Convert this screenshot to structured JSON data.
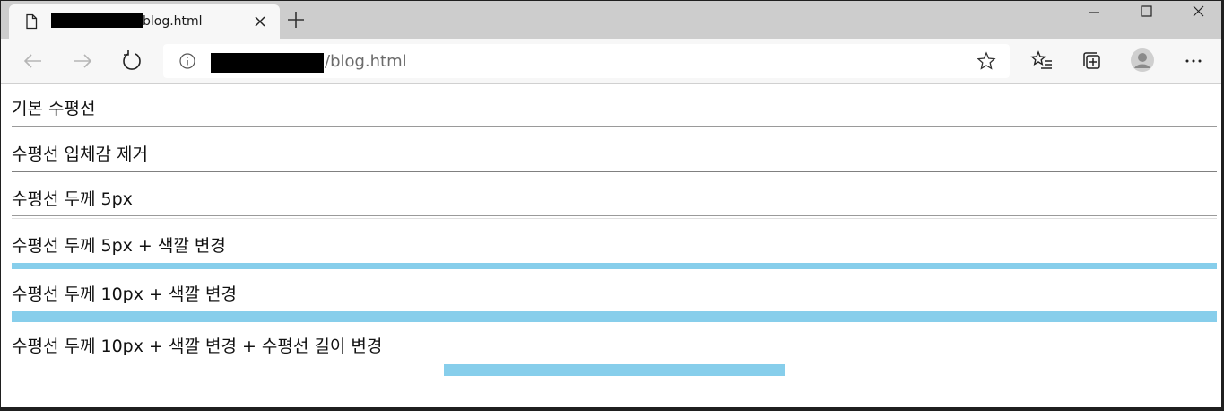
{
  "browser": {
    "tab_title": "blog.html",
    "url_text": "/blog.html",
    "new_tab_symbol": "+"
  },
  "icons": {
    "page": "page-icon",
    "close": "close-icon",
    "back": "arrow-left-icon",
    "forward": "arrow-right-icon",
    "refresh": "refresh-icon",
    "info": "info-icon",
    "star": "star-icon",
    "favorites": "favorites-icon",
    "collections": "collections-icon",
    "profile": "profile-icon",
    "more": "more-icon"
  },
  "sections": [
    {
      "label": "기본 수평선"
    },
    {
      "label": "수평선 입체감 제거"
    },
    {
      "label": "수평선 두께 5px"
    },
    {
      "label": "수평선 두께 5px + 색깔 변경"
    },
    {
      "label": "수평선 두께 10px + 색깔 변경"
    },
    {
      "label": "수평선 두께 10px + 색깔 변경 + 수평선 길이 변경"
    }
  ],
  "colors": {
    "hr_accent": "#87ceeb",
    "hr_default": "#9a9a9a"
  }
}
